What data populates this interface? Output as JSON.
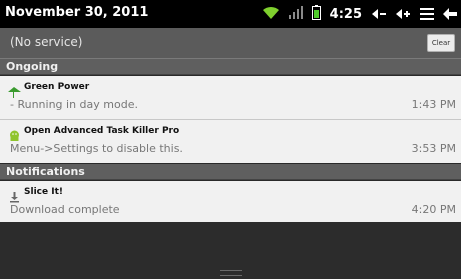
{
  "status_bar": {
    "date": "November 30, 2011",
    "time": "4:25",
    "icons": [
      "wifi-icon",
      "signal-icon",
      "battery-icon",
      "volume-down-icon",
      "volume-up-icon",
      "menu-icon",
      "back-icon"
    ]
  },
  "service": {
    "text": "(No service)",
    "clear_label": "Clear"
  },
  "sections": {
    "ongoing": "Ongoing",
    "notifications": "Notifications"
  },
  "ongoing_items": [
    {
      "title": "Green Power",
      "subtitle": "- Running in day mode.",
      "time": "1:43 PM",
      "icon": "leaf-icon"
    },
    {
      "title": "Open Advanced Task Killer Pro",
      "subtitle": "Menu->Settings to disable this.",
      "time": "3:53 PM",
      "icon": "android-icon"
    }
  ],
  "notification_items": [
    {
      "title": "Slice It!",
      "subtitle": "Download complete",
      "time": "4:20 PM",
      "icon": "download-icon"
    }
  ],
  "colors": {
    "wifi": "#7fd02e",
    "battery": "#4fcc2a",
    "leaf": "#3a9a2e",
    "android": "#8fc42e"
  }
}
